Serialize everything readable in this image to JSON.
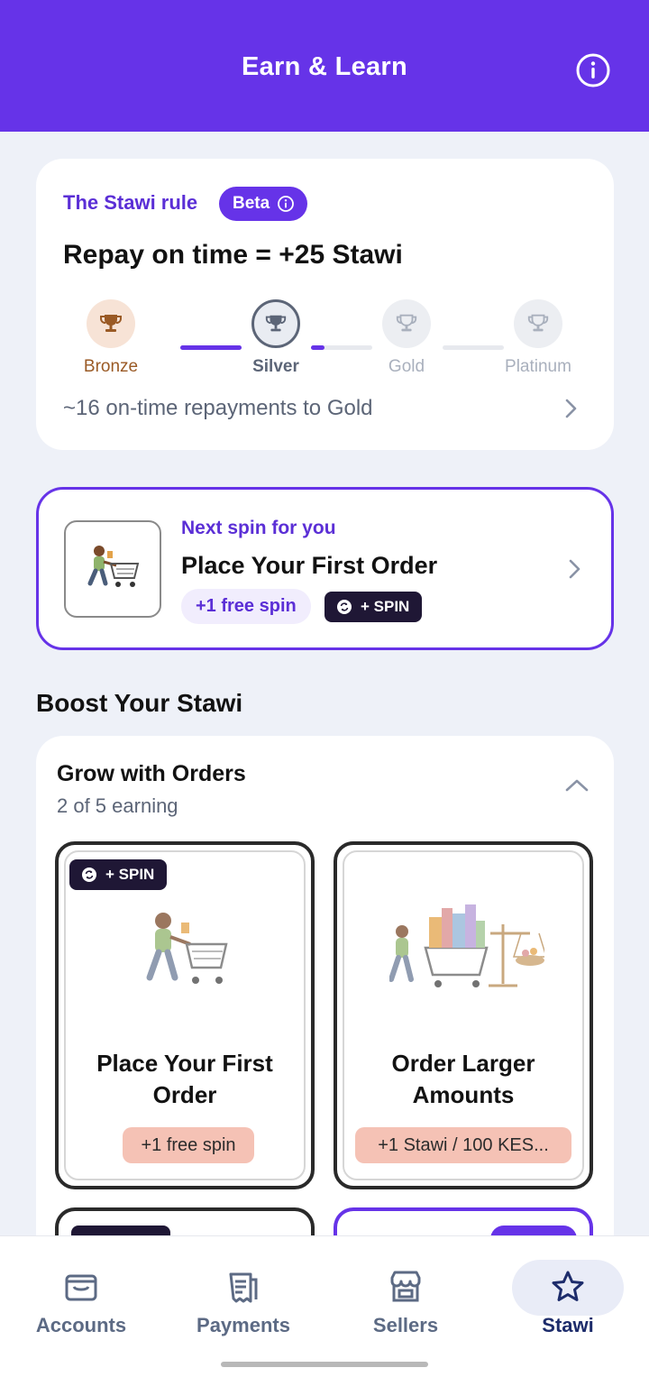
{
  "header": {
    "title": "Earn & Learn",
    "info_icon": "info-icon"
  },
  "rule": {
    "label": "The Stawi rule",
    "badge": "Beta",
    "title": "Repay on time = +25 Stawi",
    "tiers": [
      {
        "name": "Bronze",
        "state": "achieved",
        "color": "#9a5a25"
      },
      {
        "name": "Silver",
        "state": "current",
        "color": "#5c6577"
      },
      {
        "name": "Gold",
        "state": "locked",
        "color": "#a9b0bd"
      },
      {
        "name": "Platinum",
        "state": "locked",
        "color": "#a9b0bd"
      }
    ],
    "progress": [
      1.0,
      0.22,
      0.0
    ],
    "footer": "~16 on-time repayments to Gold"
  },
  "next_spin": {
    "subtitle": "Next spin for you",
    "title": "Place Your First Order",
    "chip_free": "+1 free spin",
    "chip_spin": "+ SPIN"
  },
  "boost": {
    "section_title": "Boost Your Stawi",
    "group_title": "Grow with Orders",
    "group_sub": "2 of 5 earning",
    "tiles": [
      {
        "title": "Place Your First Order",
        "chip": "+1 free spin",
        "spin_badge": "+ SPIN"
      },
      {
        "title": "Order Larger Amounts",
        "chip": "+1 Stawi / 100 KES..."
      }
    ]
  },
  "nav": {
    "items": [
      {
        "label": "Accounts",
        "icon": "wallet-icon",
        "active": false
      },
      {
        "label": "Payments",
        "icon": "receipt-icon",
        "active": false
      },
      {
        "label": "Sellers",
        "icon": "store-icon",
        "active": false
      },
      {
        "label": "Stawi",
        "icon": "star-icon",
        "active": true
      }
    ]
  },
  "colors": {
    "brand": "#6633e8",
    "nav_active": "#1d2c6b",
    "nav_inactive": "#5c6a84",
    "chip_peach": "#f5c2b5",
    "spin_badge": "#1f1735"
  }
}
